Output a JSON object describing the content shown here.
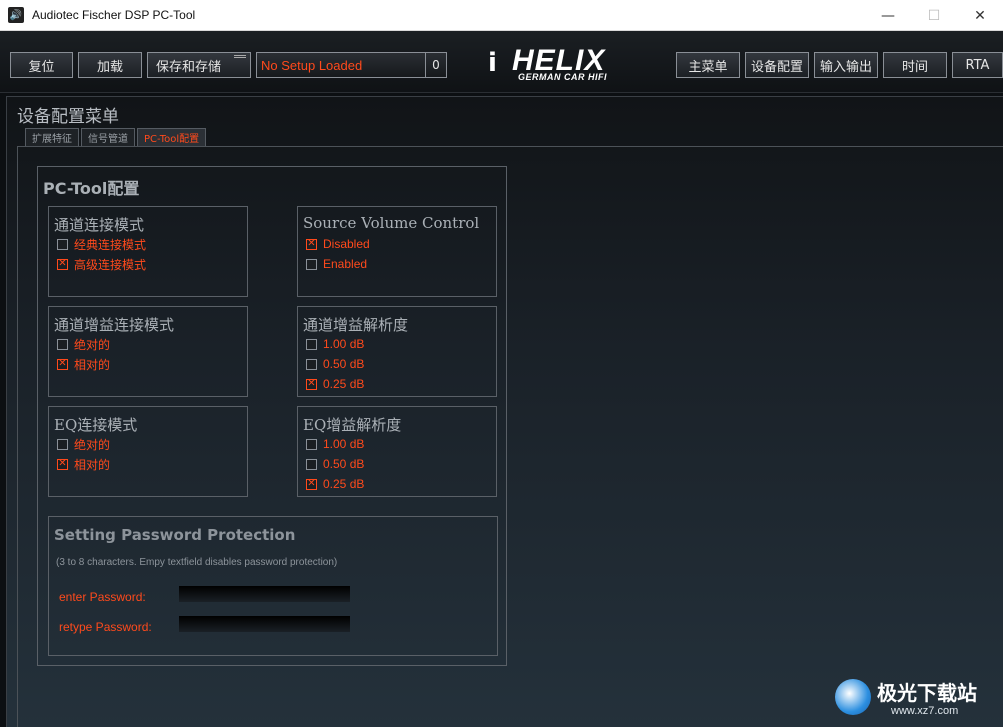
{
  "window": {
    "title": "Audiotec Fischer DSP PC-Tool",
    "icon": "speaker-icon",
    "minimize": "—",
    "maximize": "☐",
    "close": "✕"
  },
  "toolbar": {
    "reset": "复位",
    "load": "加载",
    "save": "保存和存储",
    "setup_status": "No Setup Loaded",
    "setup_number": "0",
    "main_menu": "主菜单",
    "device_config": "设备配置",
    "io": "输入输出",
    "time": "时间",
    "rta": "RTA"
  },
  "logo": {
    "mark": "i",
    "word": "HELIX",
    "sub": "GERMAN CAR HIFI"
  },
  "page": {
    "title": "设备配置菜单",
    "tabs": [
      {
        "label": "扩展特征",
        "active": false
      },
      {
        "label": "信号管道",
        "active": false
      },
      {
        "label": "PC-Tool配置",
        "active": true
      }
    ]
  },
  "pc_config": {
    "title": "PC-Tool配置",
    "channel_link_mode": {
      "title": "通道连接模式",
      "options": [
        {
          "label": "经典连接模式",
          "checked": false
        },
        {
          "label": "高级连接模式",
          "checked": true
        }
      ]
    },
    "source_volume": {
      "title": "Source Volume Control",
      "options": [
        {
          "label": "Disabled",
          "checked": true
        },
        {
          "label": "Enabled",
          "checked": false
        }
      ]
    },
    "gain_link_mode": {
      "title": "通道增益连接模式",
      "options": [
        {
          "label": "绝对的",
          "checked": false
        },
        {
          "label": "相对的",
          "checked": true
        }
      ]
    },
    "gain_resolution": {
      "title": "通道增益解析度",
      "options": [
        {
          "label": "1.00 dB",
          "checked": false
        },
        {
          "label": "0.50 dB",
          "checked": false
        },
        {
          "label": "0.25 dB",
          "checked": true
        }
      ]
    },
    "eq_link_mode": {
      "title": "EQ连接模式",
      "options": [
        {
          "label": "绝对的",
          "checked": false
        },
        {
          "label": "相对的",
          "checked": true
        }
      ]
    },
    "eq_gain_resolution": {
      "title": "EQ增益解析度",
      "options": [
        {
          "label": "1.00 dB",
          "checked": false
        },
        {
          "label": "0.50 dB",
          "checked": false
        },
        {
          "label": "0.25 dB",
          "checked": true
        }
      ]
    },
    "password": {
      "title": "Setting Password Protection",
      "note": "(3 to 8 characters. Empy textfield disables password protection)",
      "enter_label": "enter Password:",
      "retype_label": "retype Password:",
      "enter_value": "",
      "retype_value": ""
    }
  },
  "watermark": {
    "text": "极光下载站",
    "url": "www.xz7.com"
  },
  "colors": {
    "accent": "#ff4a1c",
    "text_muted": "#aab0b6",
    "border": "#5a6067"
  }
}
